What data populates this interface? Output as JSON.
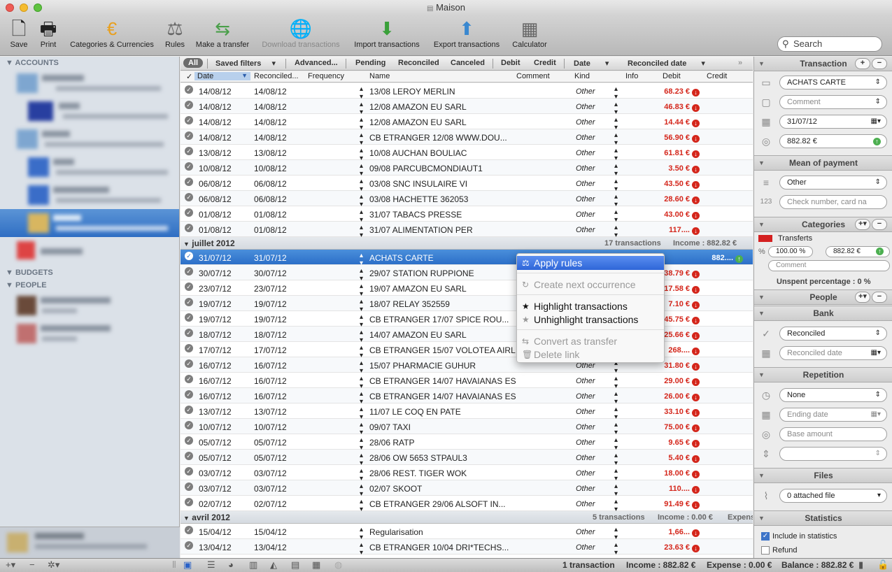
{
  "window": {
    "title": "Maison"
  },
  "toolbar": {
    "save": "Save",
    "print": "Print",
    "categories": "Categories & Currencies",
    "rules": "Rules",
    "transfer": "Make a transfer",
    "download": "Download transactions",
    "import": "Import transactions",
    "export": "Export transactions",
    "calculator": "Calculator",
    "search_placeholder": "Search"
  },
  "sidebar": {
    "accounts": "ACCOUNTS",
    "budgets": "BUDGETS",
    "people": "PEOPLE"
  },
  "filters": {
    "all": "All",
    "saved": "Saved filters",
    "advanced": "Advanced...",
    "pending": "Pending",
    "reconciled": "Reconciled",
    "canceled": "Canceled",
    "debit": "Debit",
    "credit": "Credit",
    "date": "Date",
    "reconciled_date": "Reconciled date"
  },
  "columns": {
    "check": "✓",
    "date": "Date",
    "reconciled": "Reconciled...",
    "frequency": "Frequency",
    "name": "Name",
    "comment": "Comment",
    "kind": "Kind",
    "info": "Info",
    "debit": "Debit",
    "credit": "Credit"
  },
  "groups": {
    "juillet": {
      "title": "juillet 2012",
      "count": "17 transactions",
      "income": "Income : 882.82 €"
    },
    "avril": {
      "title": "avril 2012",
      "count": "5 transactions",
      "income": "Income : 0.00 €",
      "expense": "Expens"
    }
  },
  "rows_aug": [
    {
      "date": "14/08/12",
      "rec": "14/08/12",
      "name": "13/08 LEROY MERLIN",
      "kind": "Other",
      "debit": "68.23 €"
    },
    {
      "date": "14/08/12",
      "rec": "14/08/12",
      "name": "12/08 AMAZON EU SARL",
      "kind": "Other",
      "debit": "46.83 €"
    },
    {
      "date": "14/08/12",
      "rec": "14/08/12",
      "name": "12/08 AMAZON EU SARL",
      "kind": "Other",
      "debit": "14.44 €"
    },
    {
      "date": "14/08/12",
      "rec": "14/08/12",
      "name": "CB ETRANGER 12/08 WWW.DOU...",
      "kind": "Other",
      "debit": "56.90 €"
    },
    {
      "date": "13/08/12",
      "rec": "13/08/12",
      "name": "10/08 AUCHAN BOULIAC",
      "kind": "Other",
      "debit": "61.81 €"
    },
    {
      "date": "10/08/12",
      "rec": "10/08/12",
      "name": "09/08 PARCUBCMONDIAUT1",
      "kind": "Other",
      "debit": "3.50 €"
    },
    {
      "date": "06/08/12",
      "rec": "06/08/12",
      "name": "03/08 SNC INSULAIRE VI",
      "kind": "Other",
      "debit": "43.50 €"
    },
    {
      "date": "06/08/12",
      "rec": "06/08/12",
      "name": "03/08 HACHETTE 362053",
      "kind": "Other",
      "debit": "28.60 €"
    },
    {
      "date": "01/08/12",
      "rec": "01/08/12",
      "name": "31/07 TABACS PRESSE",
      "kind": "Other",
      "debit": "43.00 €"
    },
    {
      "date": "01/08/12",
      "rec": "01/08/12",
      "name": "31/07 ALIMENTATION PER",
      "kind": "Other",
      "debit": "117...."
    }
  ],
  "rows_jul": [
    {
      "date": "31/07/12",
      "rec": "31/07/12",
      "name": "ACHATS CARTE",
      "kind": "",
      "debit": "",
      "credit": "882....",
      "sel": true
    },
    {
      "date": "30/07/12",
      "rec": "30/07/12",
      "name": "29/07 STATION RUPPIONE",
      "kind": "",
      "debit": "38.79 €"
    },
    {
      "date": "23/07/12",
      "rec": "23/07/12",
      "name": "19/07 AMAZON EU SARL",
      "kind": "",
      "debit": "17.58 €"
    },
    {
      "date": "19/07/12",
      "rec": "19/07/12",
      "name": "18/07 RELAY 352559",
      "kind": "",
      "debit": "7.10 €"
    },
    {
      "date": "19/07/12",
      "rec": "19/07/12",
      "name": "CB ETRANGER 17/07 SPICE ROU...",
      "kind": "",
      "debit": "45.75 €"
    },
    {
      "date": "18/07/12",
      "rec": "18/07/12",
      "name": "14/07 AMAZON EU SARL",
      "kind": "",
      "debit": "25.66 €"
    },
    {
      "date": "17/07/12",
      "rec": "17/07/12",
      "name": "CB ETRANGER 15/07 VOLOTEA AIRL",
      "kind": "",
      "debit": "268...."
    },
    {
      "date": "16/07/12",
      "rec": "16/07/12",
      "name": "15/07 PHARMACIE GUHUR",
      "kind": "Other",
      "debit": "31.80 €"
    },
    {
      "date": "16/07/12",
      "rec": "16/07/12",
      "name": "CB ETRANGER 14/07 HAVAIANAS ES",
      "kind": "Other",
      "debit": "29.00 €"
    },
    {
      "date": "16/07/12",
      "rec": "16/07/12",
      "name": "CB ETRANGER 14/07 HAVAIANAS ES",
      "kind": "Other",
      "debit": "26.00 €"
    },
    {
      "date": "13/07/12",
      "rec": "13/07/12",
      "name": "11/07 LE COQ EN PATE",
      "kind": "Other",
      "debit": "33.10 €"
    },
    {
      "date": "10/07/12",
      "rec": "10/07/12",
      "name": "09/07 TAXI",
      "kind": "Other",
      "debit": "75.00 €"
    },
    {
      "date": "05/07/12",
      "rec": "05/07/12",
      "name": "28/06 RATP",
      "kind": "Other",
      "debit": "9.65 €"
    },
    {
      "date": "05/07/12",
      "rec": "05/07/12",
      "name": "28/06 OW 5653 STPAUL3",
      "kind": "Other",
      "debit": "5.40 €"
    },
    {
      "date": "03/07/12",
      "rec": "03/07/12",
      "name": "28/06 REST. TIGER WOK",
      "kind": "Other",
      "debit": "18.00 €"
    },
    {
      "date": "03/07/12",
      "rec": "03/07/12",
      "name": "02/07 SKOOT",
      "kind": "Other",
      "debit": "110...."
    },
    {
      "date": "02/07/12",
      "rec": "02/07/12",
      "name": "CB ETRANGER 29/06 ALSOFT IN...",
      "kind": "Other",
      "debit": "91.49 €"
    }
  ],
  "rows_apr": [
    {
      "date": "15/04/12",
      "rec": "15/04/12",
      "name": "Regularisation",
      "kind": "Other",
      "debit": "1,66..."
    },
    {
      "date": "13/04/12",
      "rec": "13/04/12",
      "name": "CB ETRANGER 10/04 DRI*TECHS...",
      "kind": "Other",
      "debit": "23.63 €"
    }
  ],
  "context_menu": {
    "apply_rules": "Apply rules",
    "create_next": "Create next occurrence",
    "highlight": "Highlight transactions",
    "unhighlight": "Unhighlight transactions",
    "convert": "Convert as transfer",
    "delete_link": "Delete link"
  },
  "panel": {
    "transaction": "Transaction",
    "name": "ACHATS CARTE",
    "comment": "Comment",
    "date": "31/07/12",
    "amount": "882.82 €",
    "mean_of_payment": "Mean of payment",
    "payment": "Other",
    "check_number": "Check number, card na",
    "categories": "Categories",
    "category": "Transferts",
    "percent": "100.00 %",
    "cat_amount": "882.82 €",
    "cat_comment": "Comment",
    "unspent": "Unspent percentage : 0 %",
    "people": "People",
    "bank": "Bank",
    "bank_status": "Reconciled",
    "reconciled_date": "Reconciled date",
    "repetition": "Repetition",
    "repeat": "None",
    "ending_date": "Ending date",
    "base_amount": "Base amount",
    "files": "Files",
    "attached": "0 attached file",
    "statistics": "Statistics",
    "include_stats": "Include in statistics",
    "refund": "Refund"
  },
  "status": {
    "count": "1 transaction",
    "income": "Income : 882.82 €",
    "expense": "Expense : 0.00 €",
    "balance": "Balance : 882.82 €"
  }
}
